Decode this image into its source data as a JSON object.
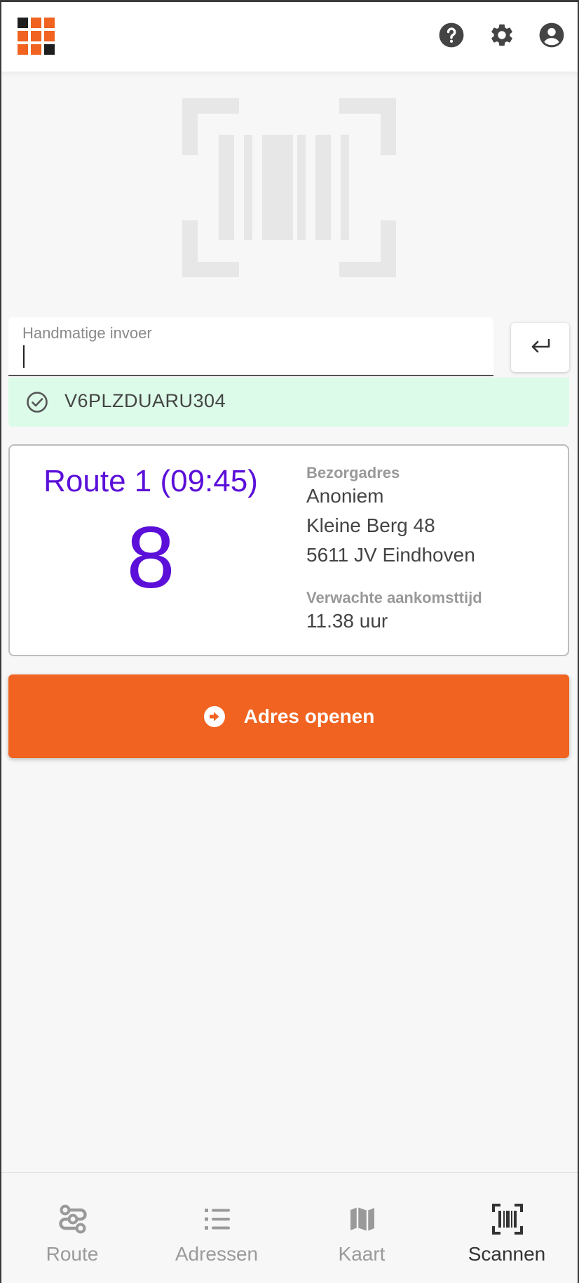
{
  "header": {
    "logo_name": "app-logo",
    "icons": [
      "help-icon",
      "settings-icon",
      "account-icon"
    ]
  },
  "colors": {
    "accent": "#f06320",
    "route": "#5b0fd9",
    "success_bg": "#dcfbe9",
    "logo_dark": "#1e1e1e"
  },
  "manual_entry": {
    "label": "Handmatige invoer",
    "value": "",
    "submit_icon": "enter-icon"
  },
  "scan_result": {
    "status_icon": "check-circle-icon",
    "code": "V6PLZDUARU304"
  },
  "route_card": {
    "title": "Route 1 (09:45)",
    "stop_number": "8",
    "address_label": "Bezorgadres",
    "address_lines": [
      "Anoniem",
      "Kleine Berg 48",
      "5611 JV Eindhoven"
    ],
    "eta_label": "Verwachte aankomsttijd",
    "eta_value": "11.38 uur"
  },
  "open_button": {
    "label": "Adres openen",
    "icon": "arrow-right-circle-icon"
  },
  "bottom_nav": {
    "items": [
      {
        "label": "Route",
        "icon": "route-icon",
        "active": false
      },
      {
        "label": "Adressen",
        "icon": "list-icon",
        "active": false
      },
      {
        "label": "Kaart",
        "icon": "map-icon",
        "active": false
      },
      {
        "label": "Scannen",
        "icon": "barcode-scan-icon",
        "active": true
      }
    ]
  }
}
